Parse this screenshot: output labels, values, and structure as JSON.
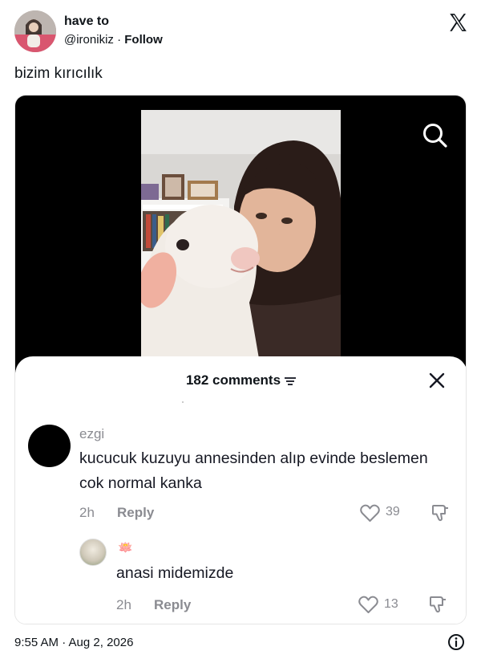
{
  "tweet": {
    "display_name": "have to",
    "handle": "@ironikiz",
    "separator": " · ",
    "follow_label": "Follow",
    "text": "bizim kırıcılık",
    "timestamp": "9:55 AM · Aug 2, 2026"
  },
  "media": {
    "comments_header": "182 comments",
    "comments": [
      {
        "username": "ezgi",
        "text": "kucucuk kuzuyu annesinden alıp evinde beslemen cok normal kanka",
        "age": "2h",
        "reply_label": "Reply",
        "likes": "39"
      },
      {
        "username": "🪷",
        "text": "anasi midemizde",
        "age": "2h",
        "reply_label": "Reply",
        "likes": "13"
      }
    ]
  },
  "icons": {
    "brand": "x-logo-icon",
    "search": "search-icon",
    "sort": "sort-icon",
    "close": "close-icon",
    "like": "heart-icon",
    "dislike": "thumbs-down-icon",
    "info": "info-icon"
  },
  "colors": {
    "text": "#0f1419",
    "muted": "#8a8b91",
    "video_bg": "#000000"
  }
}
